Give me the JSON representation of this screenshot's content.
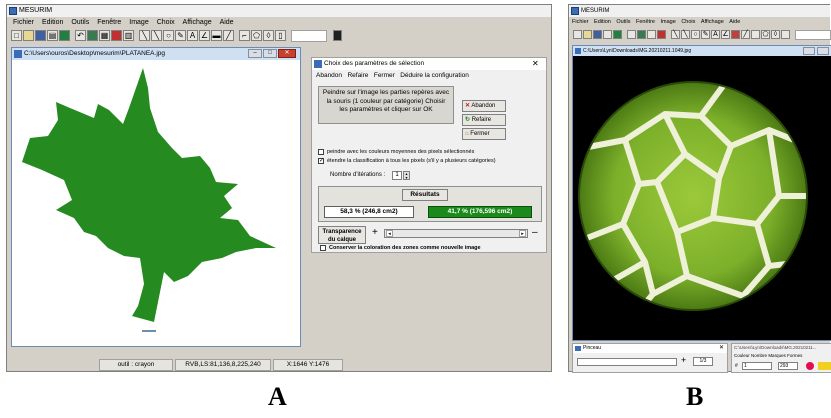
{
  "panel_a": {
    "app_title": "MESURIM",
    "menu": [
      "Fichier",
      "Edition",
      "Outils",
      "Fenêtre",
      "Image",
      "Choix",
      "Affichage",
      "Aide"
    ],
    "image_window_title": "C:\\Users\\ouros\\Desktop\\mesurim\\PLATANEA.jpg",
    "dialog": {
      "title": "Choix des paramètres de sélection",
      "menu": [
        "Abandon",
        "Refaire",
        "Fermer",
        "Déduire la configuration"
      ],
      "instructions": "Peindre sur l'image les parties repères avec la souris (1 couleur par catégorie) Choisir les paramètres et cliquer sur OK",
      "abandon_label": "Abandon",
      "refaire_label": "Refaire",
      "fermer_label": "Fermer",
      "option1": "peindre avec les couleurs moyennes des pixels sélectionnés",
      "option2": "étendre la classification à tous les pixels (s'il y a plusieurs catégories)",
      "iterations_label": "Nombre d'itérations :",
      "iterations_value": "1",
      "results_label": "Résultats",
      "result1": "58,3 % (246,8 cm2)",
      "result2": "41,7 % (176,596 cm2)",
      "transparency_label": "Transparence du calque",
      "save_option": "Conserver la coloration des zones comme nouvelle image"
    },
    "status": {
      "tool": "outil : crayon",
      "rvb": "RVB,LS:81,136,8,225,240",
      "coords": "X:1646 Y:1476"
    },
    "colors": {
      "leaf": "#258a1f",
      "result_green": "#1b8a1b"
    }
  },
  "panel_b": {
    "app_title": "MESURIM",
    "menu": [
      "Fichier",
      "Edition",
      "Outils",
      "Fenêtre",
      "Image",
      "Choix",
      "Affichage",
      "Aide"
    ],
    "image_window_title": "C:\\Users\\Lyn\\Downloads\\MG.20210211.1049.jpg",
    "bottom_window_title": "Pinceau",
    "bottom_value": "1/3",
    "bottom_path": "C:\\Users\\Lyn\\Downloads\\MG.20210211...",
    "bottom_menu": [
      "Couleur",
      "Nombre",
      "Marques",
      "Formes"
    ],
    "num_field": "1",
    "num_field2": "293"
  },
  "captions": {
    "a": "A",
    "b": "B"
  }
}
